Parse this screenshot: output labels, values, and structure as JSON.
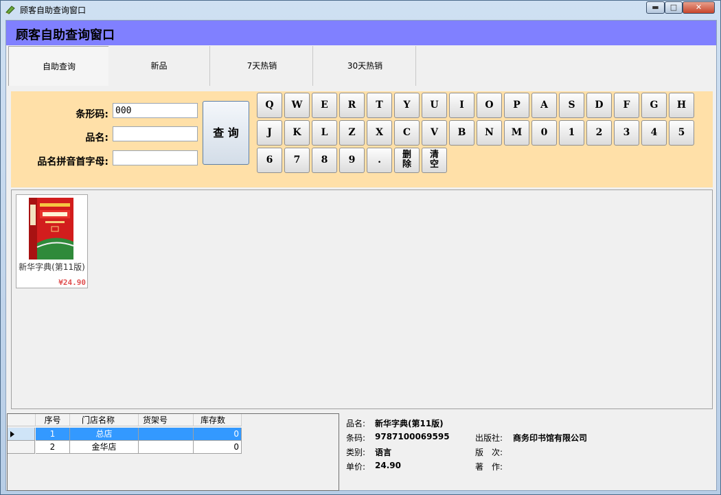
{
  "window": {
    "title": "顾客自助查询窗口",
    "min_glyph": "▬",
    "max_glyph": "□",
    "close_glyph": "✕"
  },
  "header": {
    "title": "顾客自助查询窗口",
    "band_color": "#8080ff"
  },
  "tabs": [
    {
      "label": "自助查询",
      "active": true
    },
    {
      "label": "新品",
      "active": false
    },
    {
      "label": "7天热销",
      "active": false
    },
    {
      "label": "30天热销",
      "active": false
    }
  ],
  "search": {
    "barcode_label": "条形码:",
    "barcode_value": "000",
    "name_label": "品名:",
    "name_value": "",
    "pinyin_label": "品名拼音首字母:",
    "pinyin_value": "",
    "query_button": "查 询",
    "panel_color": "#ffe0a8"
  },
  "keyboard": {
    "row1": [
      "Q",
      "W",
      "E",
      "R",
      "T",
      "Y",
      "U",
      "I",
      "O",
      "P",
      "A",
      "S",
      "D",
      "F",
      "G",
      "H"
    ],
    "row2": [
      "J",
      "K",
      "L",
      "Z",
      "X",
      "C",
      "V",
      "B",
      "N",
      "M",
      "0",
      "1",
      "2",
      "3",
      "4",
      "5"
    ],
    "row3": [
      "6",
      "7",
      "8",
      "9",
      "."
    ],
    "delete_key": [
      "删",
      "除"
    ],
    "clear_key": [
      "清",
      "空"
    ]
  },
  "products": [
    {
      "name": "新华字典(第11版)",
      "price": "¥24.90",
      "icon": "book-cover-icon"
    }
  ],
  "stock_grid": {
    "columns": [
      "序号",
      "门店名称",
      "货架号",
      "库存数"
    ],
    "rows": [
      {
        "seq": "1",
        "store": "总店",
        "shelf": "",
        "qty": "0",
        "selected": true
      },
      {
        "seq": "2",
        "store": "金华店",
        "shelf": "",
        "qty": "0",
        "selected": false
      }
    ],
    "row_pointer_icon": "row-pointer-icon",
    "selection_color": "#3399ff"
  },
  "detail": {
    "name_label": "品名:",
    "name_value": "新华字典(第11版)",
    "barcode_label": "条码:",
    "barcode_value": "9787100069595",
    "category_label": "类别:",
    "category_value": "语言",
    "price_label": "单价:",
    "price_value": "24.90",
    "publisher_label": "出版社:",
    "publisher_value": "商务印书馆有限公司",
    "edition_label": "版　次:",
    "edition_value": "",
    "author_label": "著　作:",
    "author_value": ""
  }
}
